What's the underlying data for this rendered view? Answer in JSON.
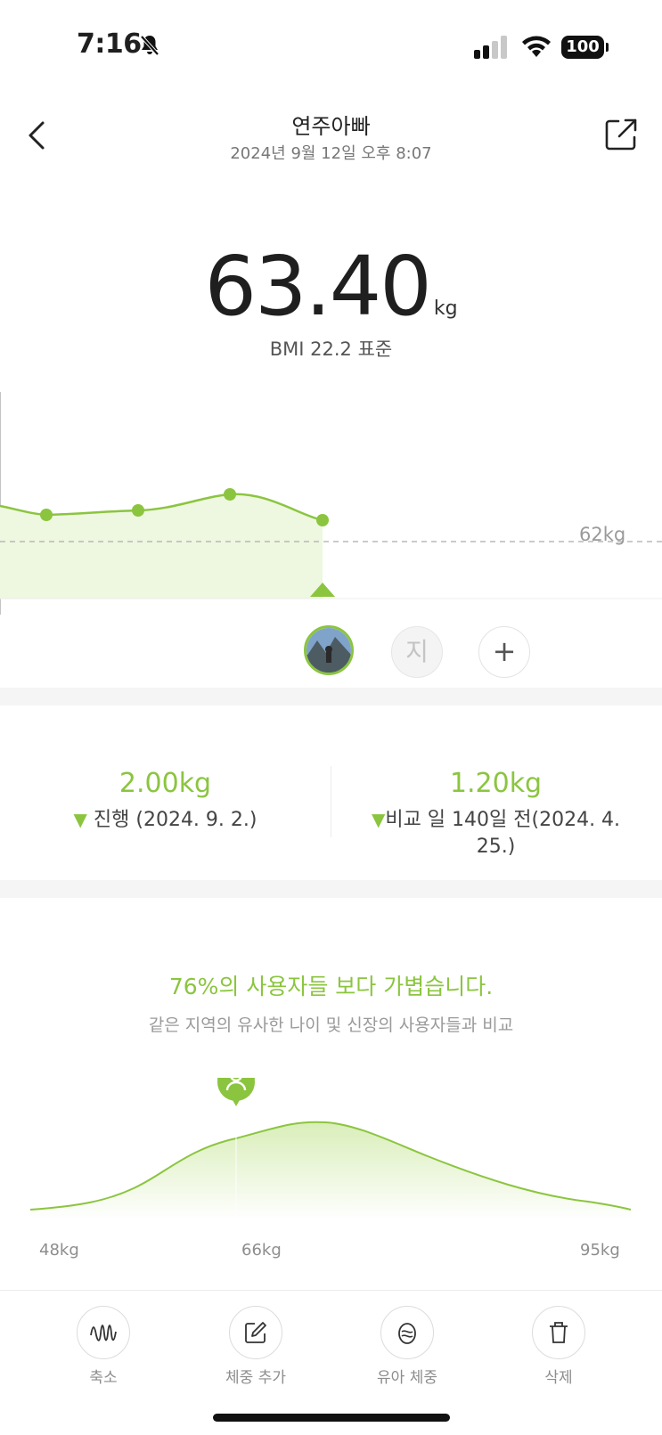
{
  "status_bar": {
    "time": "7:16",
    "battery": "100"
  },
  "header": {
    "title": "연주아빠",
    "datetime": "2024년 9월 12일 오후 8:07"
  },
  "measurement": {
    "weight": "63.40",
    "unit": "kg",
    "bmi": "BMI 22.2 표준"
  },
  "trend_chart": {
    "goal_label": "62kg",
    "values_kg": [
      63.3,
      63.4,
      63.6,
      63.3
    ],
    "goal_kg": 62
  },
  "users": {
    "selected": "photo-avatar",
    "other_initial": "지",
    "add_symbol": "+"
  },
  "comparison": {
    "left": {
      "value": "2.00kg",
      "label": "진행 (2024. 9. 2.)"
    },
    "right": {
      "value": "1.20kg",
      "label": "비교 일 140일 전(2024. 4. 25.)"
    }
  },
  "distribution": {
    "headline": "76%의 사용자들 보다 가볍습니다.",
    "subtitle": "같은 지역의 유사한 나이 및 신장의 사용자들과 비교",
    "min_label": "48kg",
    "user_label": "66kg",
    "max_label": "95kg",
    "percentile": 76
  },
  "toolbar": {
    "items": [
      {
        "label": "축소",
        "icon": "waveform-icon"
      },
      {
        "label": "체중 추가",
        "icon": "edit-icon"
      },
      {
        "label": "유아 체중",
        "icon": "baby-icon"
      },
      {
        "label": "삭제",
        "icon": "trash-icon"
      }
    ]
  },
  "colors": {
    "accent": "#8bc53f",
    "fill": "#eef7e0",
    "divider": "#ececec"
  }
}
